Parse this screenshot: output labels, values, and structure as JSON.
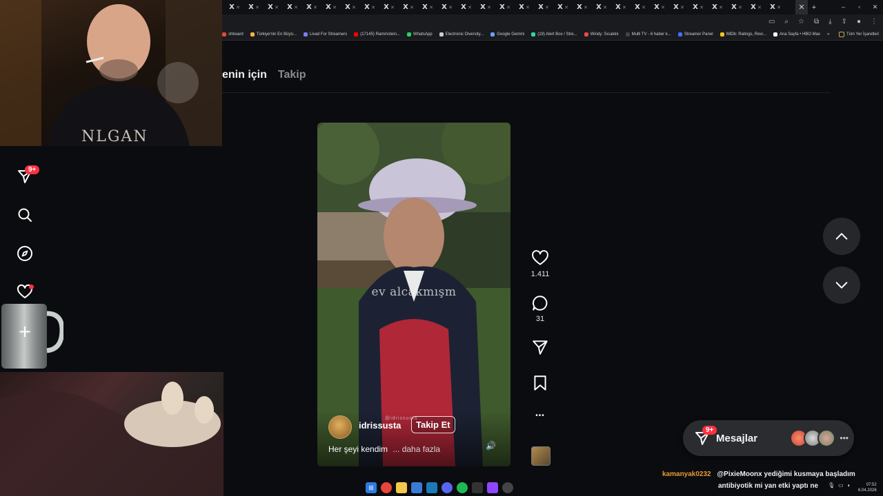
{
  "browser": {
    "tab_glyph": "X",
    "tab_count": 29,
    "new_tab_label": "+",
    "window_controls": [
      "–",
      "▫",
      "✕"
    ],
    "bookmarks": [
      {
        "label": "shboard",
        "color": "#e04a3a"
      },
      {
        "label": "Türkiye'nin En Büyü...",
        "color": "#f2b33d"
      },
      {
        "label": "Livad For Streamers",
        "color": "#7d7dff"
      },
      {
        "label": "(17145) Rammstein...",
        "color": "#ff0000"
      },
      {
        "label": "WhatsApp",
        "color": "#25d366"
      },
      {
        "label": "Electronic Diversity...",
        "color": "#cccccc"
      },
      {
        "label": "Google Gemini",
        "color": "#6aa0ff"
      },
      {
        "label": "(19) Alert Box / Stre...",
        "color": "#37d4a0"
      },
      {
        "label": "Windy: Sıcaklık",
        "color": "#e84a4a"
      },
      {
        "label": "Multi TV - 6 haber k...",
        "color": "#444444"
      },
      {
        "label": "Streamer Panel",
        "color": "#4a6cff"
      },
      {
        "label": "IMDb: Ratings, Revi...",
        "color": "#f5c518"
      },
      {
        "label": "Ana Sayfa • HBO Max",
        "color": "#ffffff"
      }
    ],
    "bookmarks_overflow": "»",
    "all_bookmarks_label": "Tüm Yer İşaretleri"
  },
  "feed": {
    "tab_active": "enin için",
    "tab_inactive": "Takip"
  },
  "sidebar": {
    "notifications_badge": "9+"
  },
  "webcam": {
    "shirt_text": "NLGAN"
  },
  "video": {
    "overlay_caption": "ev alcakmışm",
    "username": "idrissusta",
    "watermark": "@idrissusta",
    "follow_label": "Takip Et",
    "description": "Her şeyi kendim",
    "more_label": "... daha fazla",
    "sound_icon": "🔊"
  },
  "actions": {
    "likes": "1.411",
    "comments": "31",
    "more": "•••"
  },
  "messages": {
    "label": "Mesajlar",
    "badge": "9+",
    "more": "•••"
  },
  "chat": {
    "user": "kamanyak0232",
    "line1": "@PixieMoonx yediğimi kusmaya başladım",
    "line2": "antibiyotik mi yan etki yaptı ne"
  },
  "taskbar": {
    "clock_time": "07:52",
    "clock_date": "6.04.2026"
  },
  "colors": {
    "accent_red": "#ff3040",
    "chat_user": "#e89a36",
    "background": "#0b0c0f"
  }
}
